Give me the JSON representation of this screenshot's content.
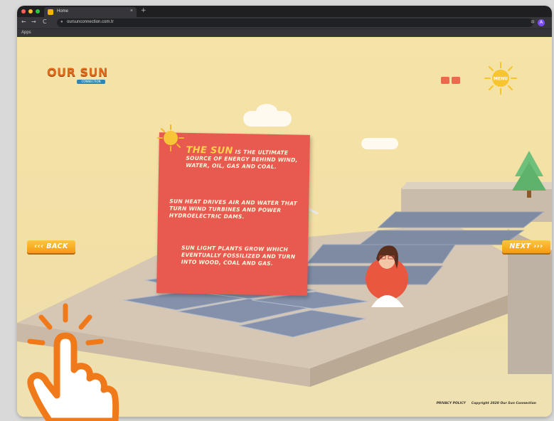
{
  "browser": {
    "tab_title": "Home",
    "tab_close": "×",
    "new_tab": "+",
    "url": "oursunconnection.com.tr",
    "back_arrow": "←",
    "forward_arrow": "→",
    "reload": "C",
    "bookmarks_label": "Apps",
    "profile_initial": "A"
  },
  "site": {
    "logo_title": "OUR SUN",
    "logo_subtitle": "CONNECTION",
    "mini_button_1": "",
    "mini_button_2": "",
    "sun_button_label": "MENU"
  },
  "poster": {
    "heading": "The Sun",
    "paragraph1": " is the ultimate source of energy behind wind, water, oil, gas and coal.",
    "paragraph2": "Sun heat drives air and water that turn wind turbines and power hydroelectric dams.",
    "paragraph3": "Sun light plants grow which eventually fossilized and turn into wood, coal and gas."
  },
  "navigation": {
    "back_label": "‹‹‹ BACK",
    "next_label": "NEXT ›››"
  },
  "footer": {
    "privacy": "PRIVACY POLICY",
    "copyright": "Copyright 2020 Our Sun Connection"
  },
  "colors": {
    "sky": "#f5e3a7",
    "poster": "#e85a4f",
    "button": "#f29b13",
    "logo": "#e06a1b",
    "hand": "#f07a1a"
  },
  "icons": [
    "sun-icon",
    "cloud-icon",
    "solar-panel-icon",
    "tree-icon",
    "wind-turbine-icon",
    "character-illustration",
    "tap-hand-icon"
  ]
}
